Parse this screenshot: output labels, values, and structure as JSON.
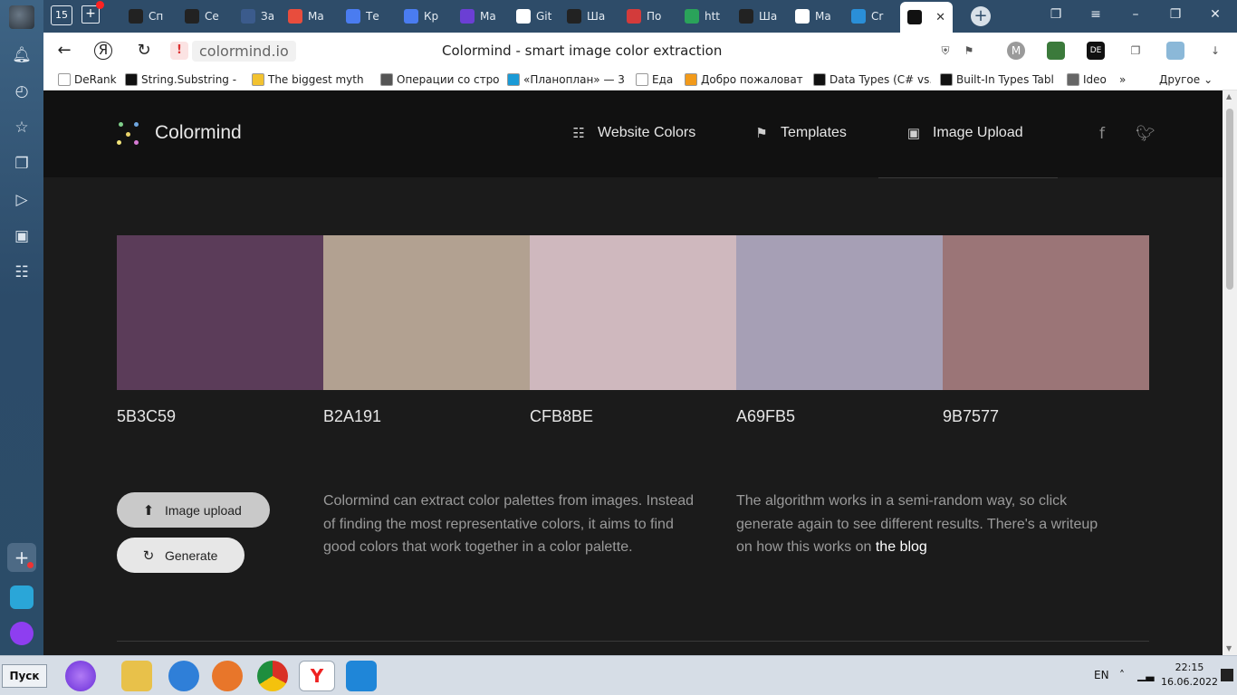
{
  "browser": {
    "tab_count_badge": "15",
    "tabs": [
      {
        "label": "Сп",
        "color": "#222222"
      },
      {
        "label": "Се",
        "color": "#222222"
      },
      {
        "label": "За",
        "color": "#3b5b8c"
      },
      {
        "label": "Ма",
        "color": "#e84d3d"
      },
      {
        "label": "Те",
        "color": "#4a7cf0"
      },
      {
        "label": "Кр",
        "color": "#4a7cf0"
      },
      {
        "label": "Ма",
        "color": "#6b3fd4"
      },
      {
        "label": "Git",
        "color": "#ffffff"
      },
      {
        "label": "Ша",
        "color": "#222222"
      },
      {
        "label": "По",
        "color": "#d33b3b"
      },
      {
        "label": "htt",
        "color": "#2aa35a"
      },
      {
        "label": "Ша",
        "color": "#222222"
      },
      {
        "label": "Ма",
        "color": "#ffffff"
      },
      {
        "label": "Cr",
        "color": "#2a8fd8"
      }
    ],
    "address": {
      "host": "colormind.io",
      "page_title": "Colormind - smart image color extraction"
    },
    "bookmarks": [
      {
        "label": "DeRank",
        "color": "#ffffff"
      },
      {
        "label": "String.Substring - ",
        "color": "#111111"
      },
      {
        "label": "The biggest myth ",
        "color": "#f2c230"
      },
      {
        "label": "Операции со стро",
        "color": "#555555"
      },
      {
        "label": "«Планоплан» — 3",
        "color": "#1a9ad6"
      },
      {
        "label": "Еда",
        "color": "#ffffff"
      },
      {
        "label": "Добро пожаловат",
        "color": "#f29a1a"
      },
      {
        "label": "Data Types (C# vs.",
        "color": "#111111"
      },
      {
        "label": "Built-In Types Tabl",
        "color": "#111111"
      },
      {
        "label": "Ideo",
        "color": "#666666"
      }
    ],
    "bookmarks_other": "Другое"
  },
  "site": {
    "logo": "Colormind",
    "nav": [
      {
        "label": "Website Colors",
        "icon": "grid-icon"
      },
      {
        "label": "Templates",
        "icon": "bookmark-icon"
      },
      {
        "label": "Image Upload",
        "icon": "camera-icon"
      }
    ],
    "social": [
      "facebook-icon",
      "twitter-icon"
    ],
    "palette": [
      {
        "hex": "5B3C59",
        "color": "#5B3C59"
      },
      {
        "hex": "B2A191",
        "color": "#B2A191"
      },
      {
        "hex": "CFB8BE",
        "color": "#CFB8BE"
      },
      {
        "hex": "A69FB5",
        "color": "#A69FB5"
      },
      {
        "hex": "9B7577",
        "color": "#9B7577"
      }
    ],
    "buttons": {
      "upload": "Image upload",
      "generate": "Generate"
    },
    "description_1": "Colormind can extract color palettes from images. Instead of finding the most representative colors, it aims to find good colors that work together in a color palette.",
    "description_2_text": "The algorithm works in a semi-random way, so click generate again to see different results. There's a writeup on how this works on ",
    "description_2_link": "the blog"
  },
  "taskbar": {
    "start": "Пуск",
    "lang": "EN",
    "time": "22:15",
    "date": "16.06.2022"
  }
}
